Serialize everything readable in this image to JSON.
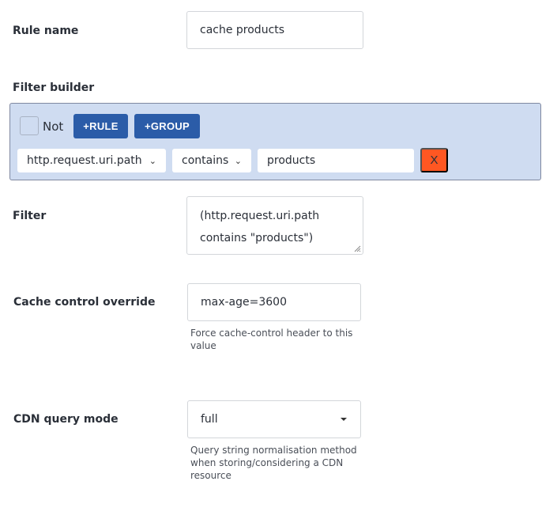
{
  "rule_name": {
    "label": "Rule name",
    "value": "cache products"
  },
  "filter_builder": {
    "label": "Filter builder",
    "not_label": "Not",
    "not_checked": false,
    "add_rule_label": "+RULE",
    "add_group_label": "+GROUP",
    "rule": {
      "field": "http.request.uri.path",
      "operator": "contains",
      "value": "products",
      "remove_label": "X"
    },
    "colors": {
      "background": "#cfdcf1",
      "button": "#2b5ca8",
      "remove_button": "#ff5722"
    }
  },
  "filter": {
    "label": "Filter",
    "line1": "(http.request.uri.path",
    "line2": "contains \"products\")"
  },
  "cache_control": {
    "label": "Cache control override",
    "value": "max-age=3600",
    "help": "Force cache-control header to this value"
  },
  "cdn_query_mode": {
    "label": "CDN query mode",
    "value": "full",
    "help": "Query string normalisation method when storing/considering a CDN resource"
  }
}
